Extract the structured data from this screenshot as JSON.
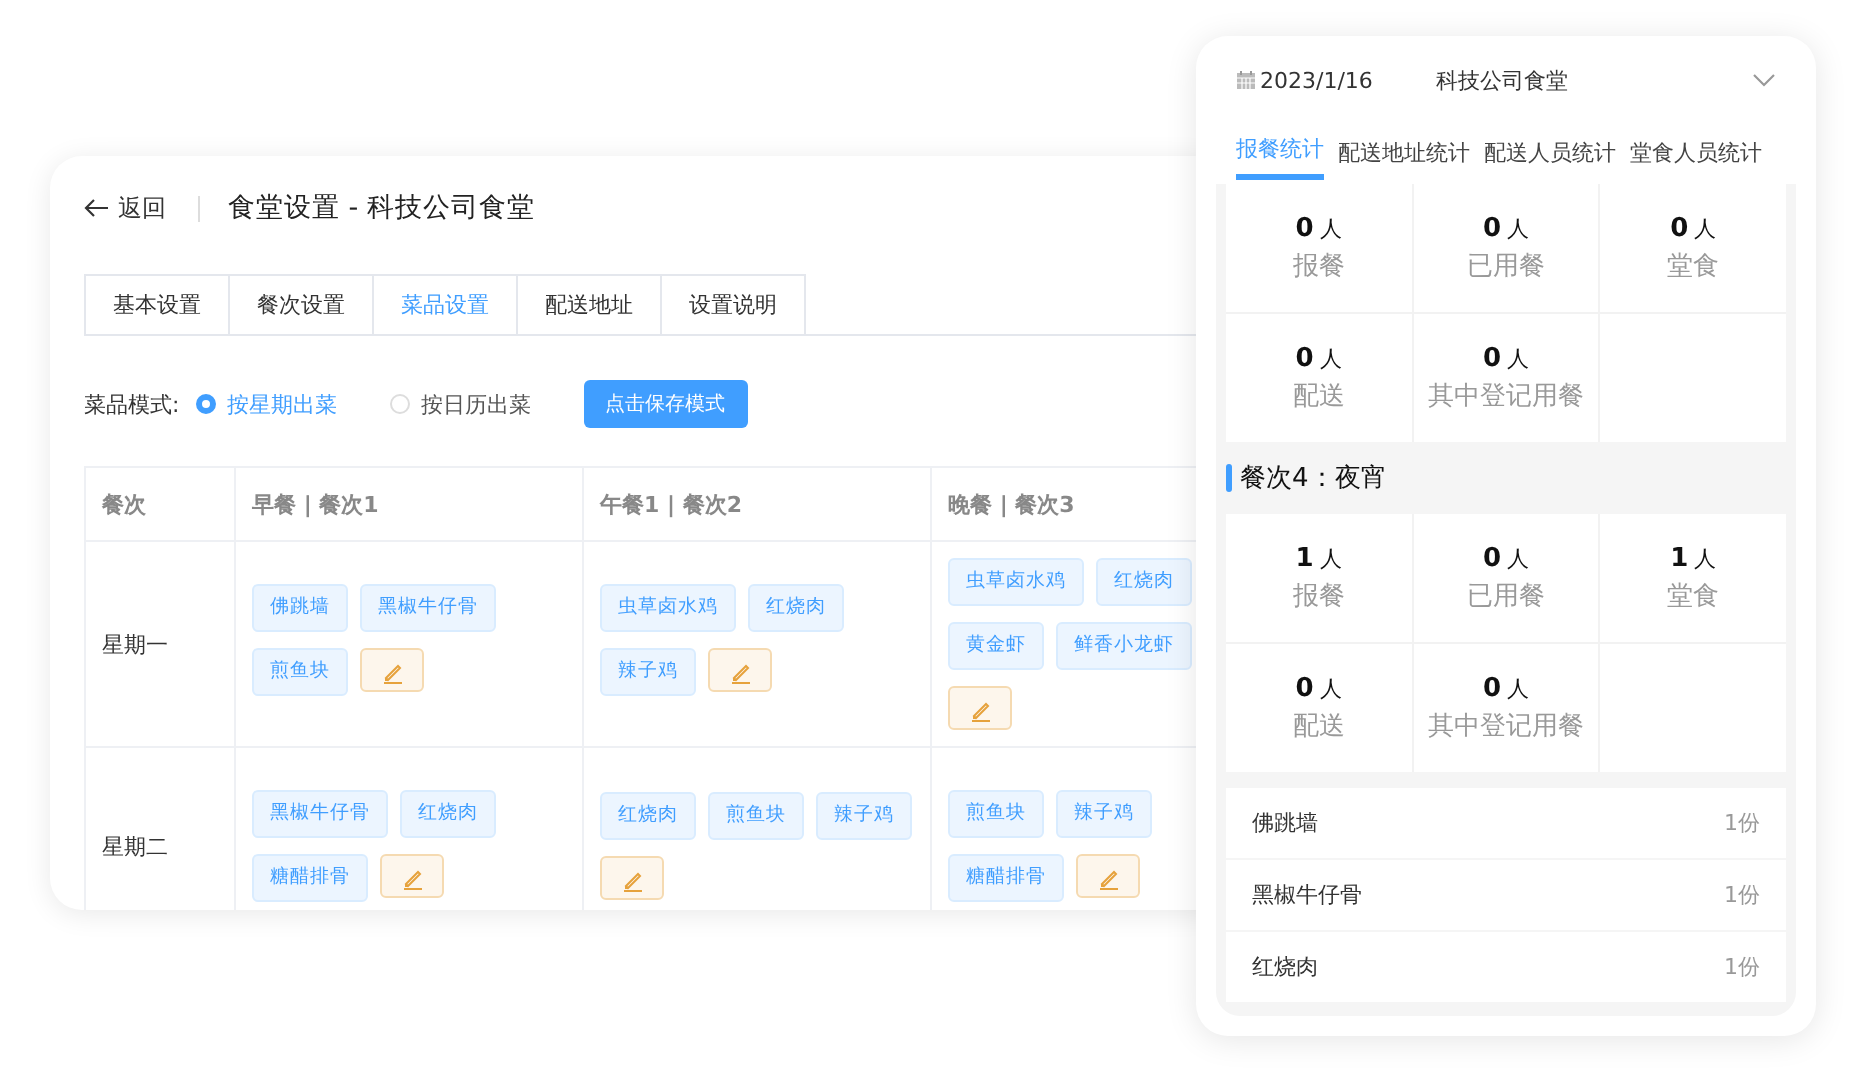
{
  "settings_window": {
    "back": "返回",
    "title": "食堂设置 - 科技公司食堂",
    "tabs": [
      {
        "label": "基本设置",
        "selected": false
      },
      {
        "label": "餐次设置",
        "selected": false
      },
      {
        "label": "菜品设置",
        "selected": true
      },
      {
        "label": "配送地址",
        "selected": false
      },
      {
        "label": "设置说明",
        "selected": false
      }
    ],
    "mode": {
      "label": "菜品模式:",
      "options": [
        {
          "label": "按星期出菜",
          "selected": true
        },
        {
          "label": "按日历出菜",
          "selected": false
        }
      ],
      "button": "点击保存模式"
    },
    "table": {
      "columns": [
        "餐次",
        "早餐 | 餐次1",
        "午餐1 | 餐次2",
        "晚餐 | 餐次3"
      ],
      "rows": [
        {
          "cells": [
            {
              "kind": "day",
              "text": "星期一"
            },
            {
              "kind": "dishes",
              "dishes": [
                "佛跳墙",
                "黑椒牛仔骨",
                "煎鱼块"
              ]
            },
            {
              "kind": "dishes",
              "dishes": [
                "虫草卤水鸡",
                "红烧肉",
                "辣子鸡"
              ]
            },
            {
              "kind": "dishes",
              "dishes": [
                "虫草卤水鸡",
                "红烧肉",
                "黄金虾",
                "鲜香小龙虾"
              ]
            }
          ]
        },
        {
          "cells": [
            {
              "kind": "day",
              "text": "星期二"
            },
            {
              "kind": "dishes",
              "dishes": [
                "黑椒牛仔骨",
                "红烧肉",
                "糖醋排骨"
              ]
            },
            {
              "kind": "dishes",
              "dishes": [
                "红烧肉",
                "煎鱼块",
                "辣子鸡"
              ]
            },
            {
              "kind": "dishes",
              "dishes": [
                "煎鱼块",
                "辣子鸡",
                "糖醋排骨"
              ]
            }
          ]
        }
      ]
    }
  },
  "mobile": {
    "date": "2023/1/16",
    "canteen": "科技公司食堂",
    "tabs": [
      {
        "label": "报餐统计",
        "selected": true
      },
      {
        "label": "配送地址统计",
        "selected": false
      },
      {
        "label": "配送人员统计",
        "selected": false
      },
      {
        "label": "堂食人员统计",
        "selected": false
      }
    ],
    "sections": [
      {
        "stats": [
          {
            "value": "0",
            "unit": "人",
            "label": "报餐"
          },
          {
            "value": "0",
            "unit": "人",
            "label": "已用餐"
          },
          {
            "value": "0",
            "unit": "人",
            "label": "堂食"
          },
          {
            "value": "0",
            "unit": "人",
            "label": "配送"
          },
          {
            "value": "0",
            "unit": "人",
            "label": "其中登记用餐"
          }
        ]
      },
      {
        "title": "餐次4：夜宵",
        "stats": [
          {
            "value": "1",
            "unit": "人",
            "label": "报餐"
          },
          {
            "value": "0",
            "unit": "人",
            "label": "已用餐"
          },
          {
            "value": "1",
            "unit": "人",
            "label": "堂食"
          },
          {
            "value": "0",
            "unit": "人",
            "label": "配送"
          },
          {
            "value": "0",
            "unit": "人",
            "label": "其中登记用餐"
          }
        ]
      }
    ],
    "dishes": [
      {
        "name": "佛跳墙",
        "qty": "1份"
      },
      {
        "name": "黑椒牛仔骨",
        "qty": "1份"
      },
      {
        "name": "红烧肉",
        "qty": "1份"
      }
    ]
  }
}
